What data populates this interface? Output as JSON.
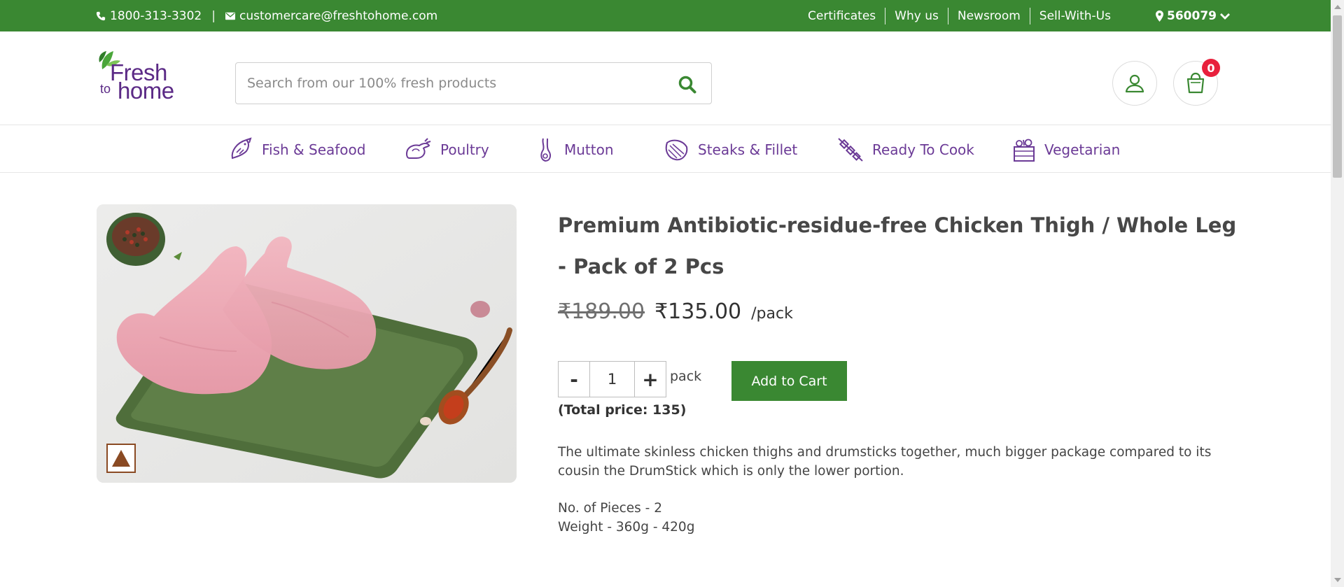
{
  "topbar": {
    "phone": "1800-313-3302",
    "separator": "|",
    "email": "customercare@freshtohome.com",
    "links": [
      "Certificates",
      "Why us",
      "Newsroom",
      "Sell-With-Us"
    ],
    "pincode": "560079"
  },
  "header": {
    "logo": {
      "line1": "Fresh",
      "line2": "to",
      "line3": "home"
    },
    "search_placeholder": "Search from our 100% fresh products",
    "cart_count": "0"
  },
  "categories": [
    {
      "label": "Fish & Seafood",
      "icon": "fish-icon"
    },
    {
      "label": "Poultry",
      "icon": "chicken-icon"
    },
    {
      "label": "Mutton",
      "icon": "mutton-leg-icon"
    },
    {
      "label": "Steaks & Fillet",
      "icon": "steak-icon"
    },
    {
      "label": "Ready To Cook",
      "icon": "skewer-icon"
    },
    {
      "label": "Vegetarian",
      "icon": "vegetable-basket-icon"
    }
  ],
  "product": {
    "title": "Premium Antibiotic-residue-free Chicken Thigh / Whole Leg - Pack of 2 Pcs",
    "old_price": "₹189.00",
    "price": "₹135.00",
    "unit": "/pack",
    "quantity": "1",
    "qty_minus": "-",
    "qty_plus": "+",
    "qty_unit": "pack",
    "add_to_cart": "Add to Cart",
    "total_price": "(Total price: 135)",
    "description": "The ultimate skinless chicken thighs and drumsticks together, much bigger package compared to its cousin the DrumStick which is only the lower portion.",
    "pieces": "No. of Pieces - 2",
    "weight": "Weight - 360g - 420g"
  },
  "colors": {
    "brand_green": "#3a8832",
    "brand_purple": "#6b3a96",
    "badge_red": "#e8203c"
  }
}
